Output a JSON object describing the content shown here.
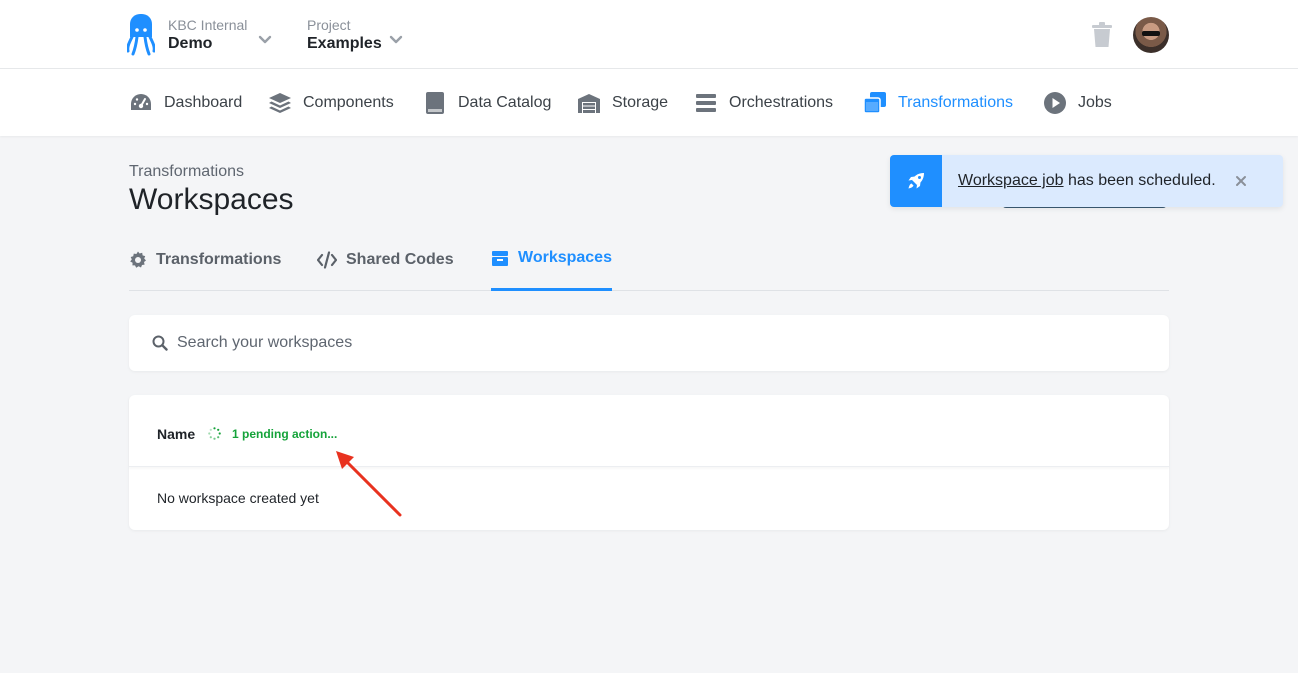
{
  "header": {
    "org_label": "KBC Internal",
    "org_name": "Demo",
    "project_label": "Project",
    "project_name": "Examples"
  },
  "nav": {
    "items": [
      {
        "label": "Dashboard",
        "icon": "dashboard-icon"
      },
      {
        "label": "Components",
        "icon": "layers-icon"
      },
      {
        "label": "Data Catalog",
        "icon": "book-icon"
      },
      {
        "label": "Storage",
        "icon": "warehouse-icon"
      },
      {
        "label": "Orchestrations",
        "icon": "bars-icon"
      },
      {
        "label": "Transformations",
        "icon": "window-restore-icon",
        "active": true
      },
      {
        "label": "Jobs",
        "icon": "play-circle-icon"
      }
    ]
  },
  "page": {
    "breadcrumb": "Transformations",
    "title": "Workspaces"
  },
  "tabs": [
    {
      "label": "Transformations",
      "icon": "gear-icon"
    },
    {
      "label": "Shared Codes",
      "icon": "code-icon"
    },
    {
      "label": "Workspaces",
      "icon": "box-icon",
      "active": true
    }
  ],
  "search": {
    "placeholder": "Search your workspaces",
    "value": ""
  },
  "table": {
    "column_name": "Name",
    "pending_text": "1 pending action...",
    "empty_text": "No workspace created yet"
  },
  "toast": {
    "link_text": "Workspace job",
    "message": " has been scheduled."
  },
  "colors": {
    "accent": "#1f8fff",
    "pending": "#15a33a",
    "toast_bg": "#dbeafe",
    "annotation": "#e8321f"
  }
}
